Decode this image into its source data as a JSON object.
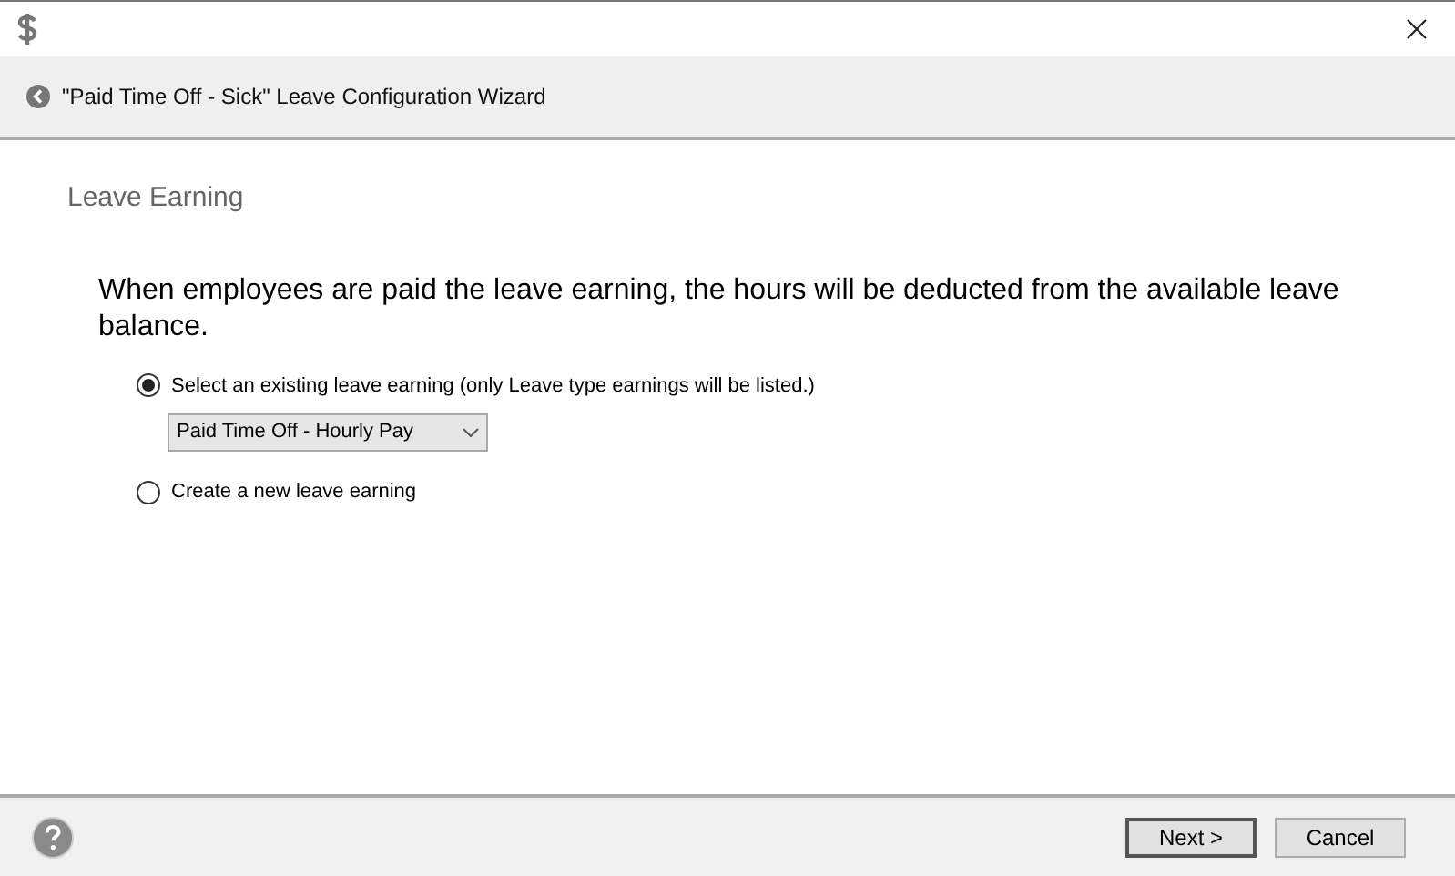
{
  "window": {
    "title": "\"Paid Time Off - Sick\" Leave Configuration Wizard"
  },
  "page": {
    "heading": "Leave Earning",
    "description": "When employees are paid the leave earning, the hours will be deducted from the available leave balance."
  },
  "options": [
    {
      "label": "Select an existing leave earning (only Leave type earnings will be listed.)",
      "selected": true,
      "dropdown": {
        "value": "Paid Time Off - Hourly Pay"
      }
    },
    {
      "label": "Create a new leave earning",
      "selected": false
    }
  ],
  "buttons": [
    {
      "label": "Next >",
      "default": true
    },
    {
      "label": "Cancel",
      "default": false
    }
  ]
}
